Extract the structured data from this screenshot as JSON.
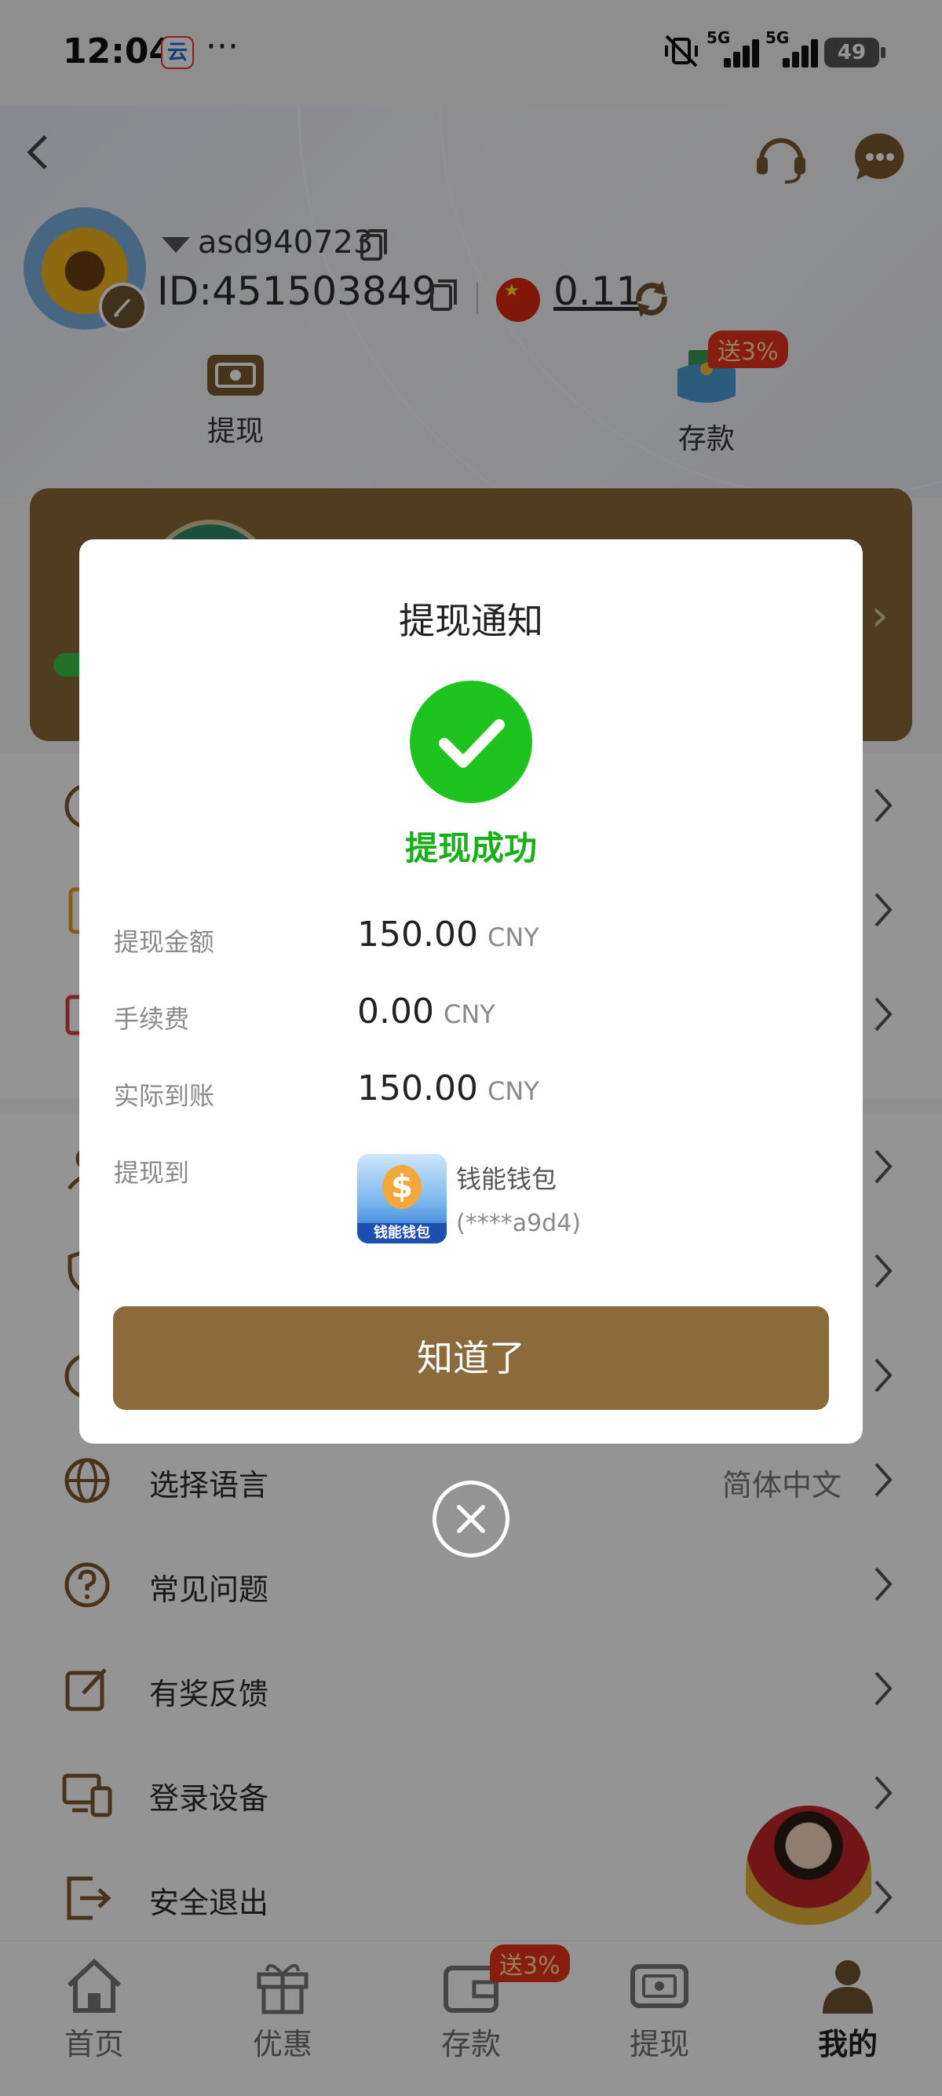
{
  "status_bar": {
    "time": "12:04",
    "app_icon_text": "云",
    "more": "···",
    "sig1": "5G",
    "sig2": "5G",
    "battery": "49"
  },
  "profile": {
    "username": "asd940723",
    "id_label": "ID:",
    "id_value": "451503849",
    "balance": "0.11",
    "actions": [
      {
        "label": "提现"
      },
      {
        "label": "存款",
        "badge": "送3%"
      }
    ]
  },
  "menu": {
    "rows": [
      {
        "label": "选择语言",
        "value": "简体中文"
      },
      {
        "label": "常见问题"
      },
      {
        "label": "有奖反馈"
      },
      {
        "label": "登录设备"
      },
      {
        "label": "安全退出"
      }
    ]
  },
  "bottom_nav": {
    "tabs": [
      {
        "label": "首页"
      },
      {
        "label": "优惠"
      },
      {
        "label": "存款",
        "badge": "送3%"
      },
      {
        "label": "提现"
      },
      {
        "label": "我的"
      }
    ],
    "active": "我的"
  },
  "dialog": {
    "title": "提现通知",
    "status": "提现成功",
    "rows": [
      {
        "label": "提现金额",
        "value": "150.00",
        "currency": "CNY"
      },
      {
        "label": "手续费",
        "value": "0.00",
        "currency": "CNY"
      },
      {
        "label": "实际到账",
        "value": "150.00",
        "currency": "CNY"
      }
    ],
    "to_label": "提现到",
    "wallet_name": "钱能钱包",
    "wallet_account": "(****a9d4)",
    "wallet_logo_text": "钱能钱包",
    "confirm_label": "知道了"
  },
  "colors": {
    "brand_brown": "#8c6a3c",
    "success_green": "#1ec31e",
    "badge_red": "#e8331c"
  }
}
